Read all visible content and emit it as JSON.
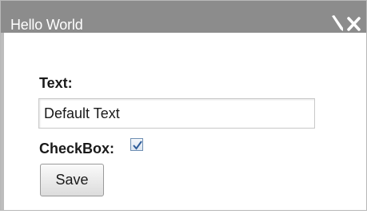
{
  "window": {
    "title": "Hello World"
  },
  "titlebar_icons": {
    "edit": "pencil-icon",
    "close": "close-icon"
  },
  "form": {
    "text_label": "Text:",
    "text_value": "Default Text",
    "checkbox_label": "CheckBox:",
    "checkbox_checked": true,
    "save_label": "Save"
  },
  "colors": {
    "titlebar": "#8c8c8c",
    "title_text": "#ffffff",
    "checkbox_border": "#6f8fb3",
    "checkmark": "#2f5d9a"
  }
}
